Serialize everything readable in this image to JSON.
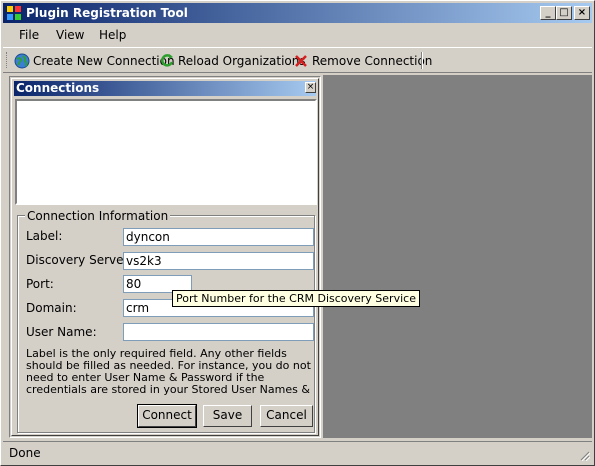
{
  "window": {
    "title": "Plugin Registration Tool"
  },
  "menu": {
    "file": "File",
    "view": "View",
    "help": "Help"
  },
  "toolbar": {
    "create": "Create New Connection",
    "reload": "Reload Organizations",
    "remove": "Remove Connection"
  },
  "panel": {
    "title": "Connections",
    "group_title": "Connection Information",
    "fields": {
      "label_label": "Label:",
      "label_value": "dyncon",
      "discovery_label": "Discovery Server:",
      "discovery_value": "vs2k3",
      "port_label": "Port:",
      "port_value": "80",
      "domain_label": "Domain:",
      "domain_value": "crm",
      "username_label": "User Name:",
      "username_value": ""
    },
    "help_text": "Label is the only required field. Any other fields should be filled as needed. For instance, you do not need to enter User Name & Password if the credentials are stored in your Stored User Names &",
    "buttons": {
      "connect": "Connect",
      "save": "Save",
      "cancel": "Cancel"
    }
  },
  "tooltip": "Port Number for the CRM Discovery Service",
  "status": "Done",
  "icons": {
    "app": "app-icon",
    "create": "globe-icon",
    "reload": "refresh-icon",
    "remove": "red-x-icon"
  }
}
